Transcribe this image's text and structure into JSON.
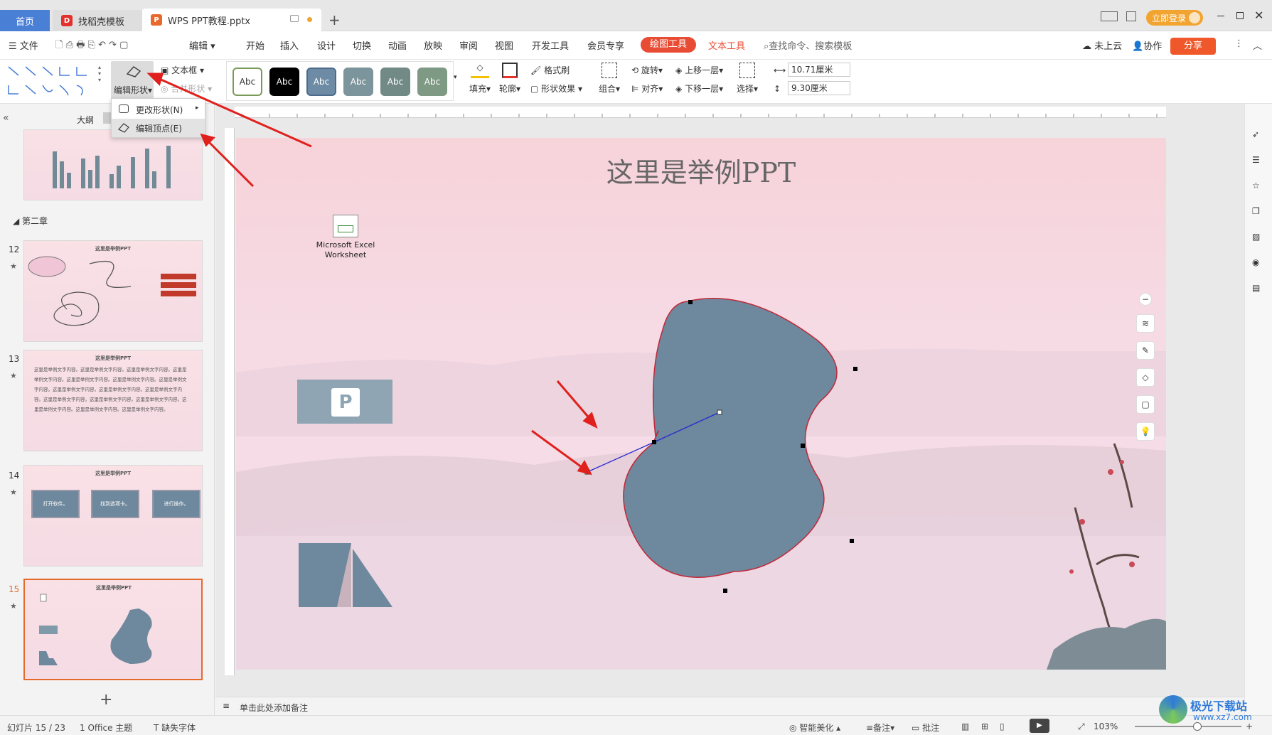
{
  "tabs": {
    "home": "首页",
    "template": "找稻壳模板",
    "doc": "WPS PPT教程.pptx",
    "new_tab": "+"
  },
  "login": "立即登录",
  "menu": {
    "file": "文件",
    "edit": "编辑",
    "start": "开始",
    "insert": "插入",
    "design": "设计",
    "switch": "切换",
    "animation": "动画",
    "slideshow": "放映",
    "review": "审阅",
    "view": "视图",
    "developer": "开发工具",
    "member": "会员专享",
    "draw_tools": "绘图工具",
    "text_tools": "文本工具",
    "search": "查找命令、搜索模板",
    "cloud": "未上云",
    "collab": "协作",
    "share": "分享"
  },
  "ribbon": {
    "edit_shape": "编辑形状",
    "textbox": "文本框",
    "merge_shape": "合并形状",
    "styles": [
      "Abc",
      "Abc",
      "Abc",
      "Abc",
      "Abc",
      "Abc"
    ],
    "fill": "填充",
    "outline": "轮廓",
    "format_painter": "格式刷",
    "shape_effect": "形状效果",
    "group": "组合",
    "rotate": "旋转",
    "align": "对齐",
    "bring_forward": "上移一层",
    "send_backward": "下移一层",
    "select": "选择",
    "width": "10.71厘米",
    "height": "9.30厘米"
  },
  "dropdown": {
    "change_shape": "更改形状(N)",
    "edit_points": "编辑顶点(E)"
  },
  "left_panel": {
    "outline_tab": "大纲",
    "chapter": "第二章",
    "slides": [
      {
        "num": "12",
        "title": "这里是举例PPT"
      },
      {
        "num": "13",
        "title": "这里是举例PPT",
        "body": "这里是举例文字内容。这里是举例文字内容。这里是举例文字内容。这里是举例文字内容。这里是举例文字内容。这里是举例文字内容。这里是举例文字内容。这里是举例文字内容。这里是举例文字内容。这里是举例文字内容。这里是举例文字内容。这里是举例文字内容。这里是举例文字内容。这里是举例文字内容。这里是举例文字内容。这里是举例文字内容。"
      },
      {
        "num": "14",
        "title": "这里是举例PPT",
        "boxes": [
          "打开软件。",
          "找到选项卡。",
          "进行操作。"
        ]
      },
      {
        "num": "15",
        "title": "这里是举例PPT"
      }
    ],
    "add": "+"
  },
  "slide": {
    "title": "这里是举例PPT",
    "excel_label_1": "Microsoft Excel",
    "excel_label_2": "Worksheet",
    "ppt_letter": "P"
  },
  "notes": "单击此处添加备注",
  "status": {
    "slide_count": "幻灯片 15 / 23",
    "theme": "1 Office 主题",
    "missing_font": "缺失字体",
    "beautify": "智能美化",
    "notes_btn": "备注",
    "comment": "批注",
    "zoom": "103%"
  },
  "watermark": "极光下载站",
  "watermark_url": "www.xz7.com",
  "colors": {
    "accent_red": "#e94c35",
    "shape_fill": "#6e889d",
    "home_tab": "#4a7fd6"
  }
}
